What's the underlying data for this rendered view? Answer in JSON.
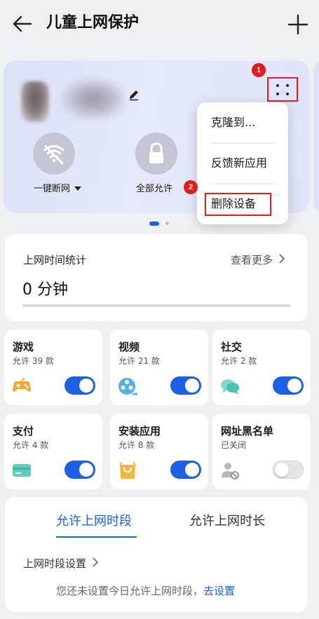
{
  "header": {
    "title": "儿童上网保护",
    "back_icon": "arrow-left-icon",
    "add_icon": "plus-icon"
  },
  "device": {
    "badge_1": "1",
    "badge_2": "2",
    "actions": [
      {
        "label": "一键断网",
        "icon": "wifi-off-icon",
        "has_dropdown": true
      },
      {
        "label": "全部允许",
        "icon": "lock-icon",
        "has_dropdown": false
      }
    ]
  },
  "popup_menu": {
    "items": [
      "克隆到...",
      "反馈新应用",
      "删除设备"
    ]
  },
  "stats": {
    "title": "上网时间统计",
    "more": "查看更多",
    "value": "0 分钟"
  },
  "apps": [
    {
      "name": "游戏",
      "sub": "允许 39 款",
      "icon": "gamepad-icon",
      "enabled": true
    },
    {
      "name": "视频",
      "sub": "允许 21 款",
      "icon": "video-reel-icon",
      "enabled": true
    },
    {
      "name": "社交",
      "sub": "允许 2 款",
      "icon": "chat-bubbles-icon",
      "enabled": true
    },
    {
      "name": "支付",
      "sub": "允许 4 款",
      "icon": "card-icon",
      "enabled": true
    },
    {
      "name": "安装应用",
      "sub": "允许 8 款",
      "icon": "shopping-bag-icon",
      "enabled": true
    },
    {
      "name": "网址黑名单",
      "sub": "已关闭",
      "icon": "user-blocked-icon",
      "enabled": false
    }
  ],
  "time_limits": {
    "tabs": [
      "允许上网时段",
      "允许上网时长"
    ],
    "active_tab": 0,
    "setting_label": "上网时段设置",
    "hint": "您还未设置今日允许上网时段，",
    "hint_link": "去设置"
  },
  "colors": {
    "accent": "#1d5fe5",
    "highlight_red": "#e02020",
    "game_orange": "#f7a531",
    "video_blue": "#58b0e0",
    "social_teal": "#45c4b0",
    "pay_teal": "#5ccfb8",
    "bag_orange": "#f5b640"
  }
}
